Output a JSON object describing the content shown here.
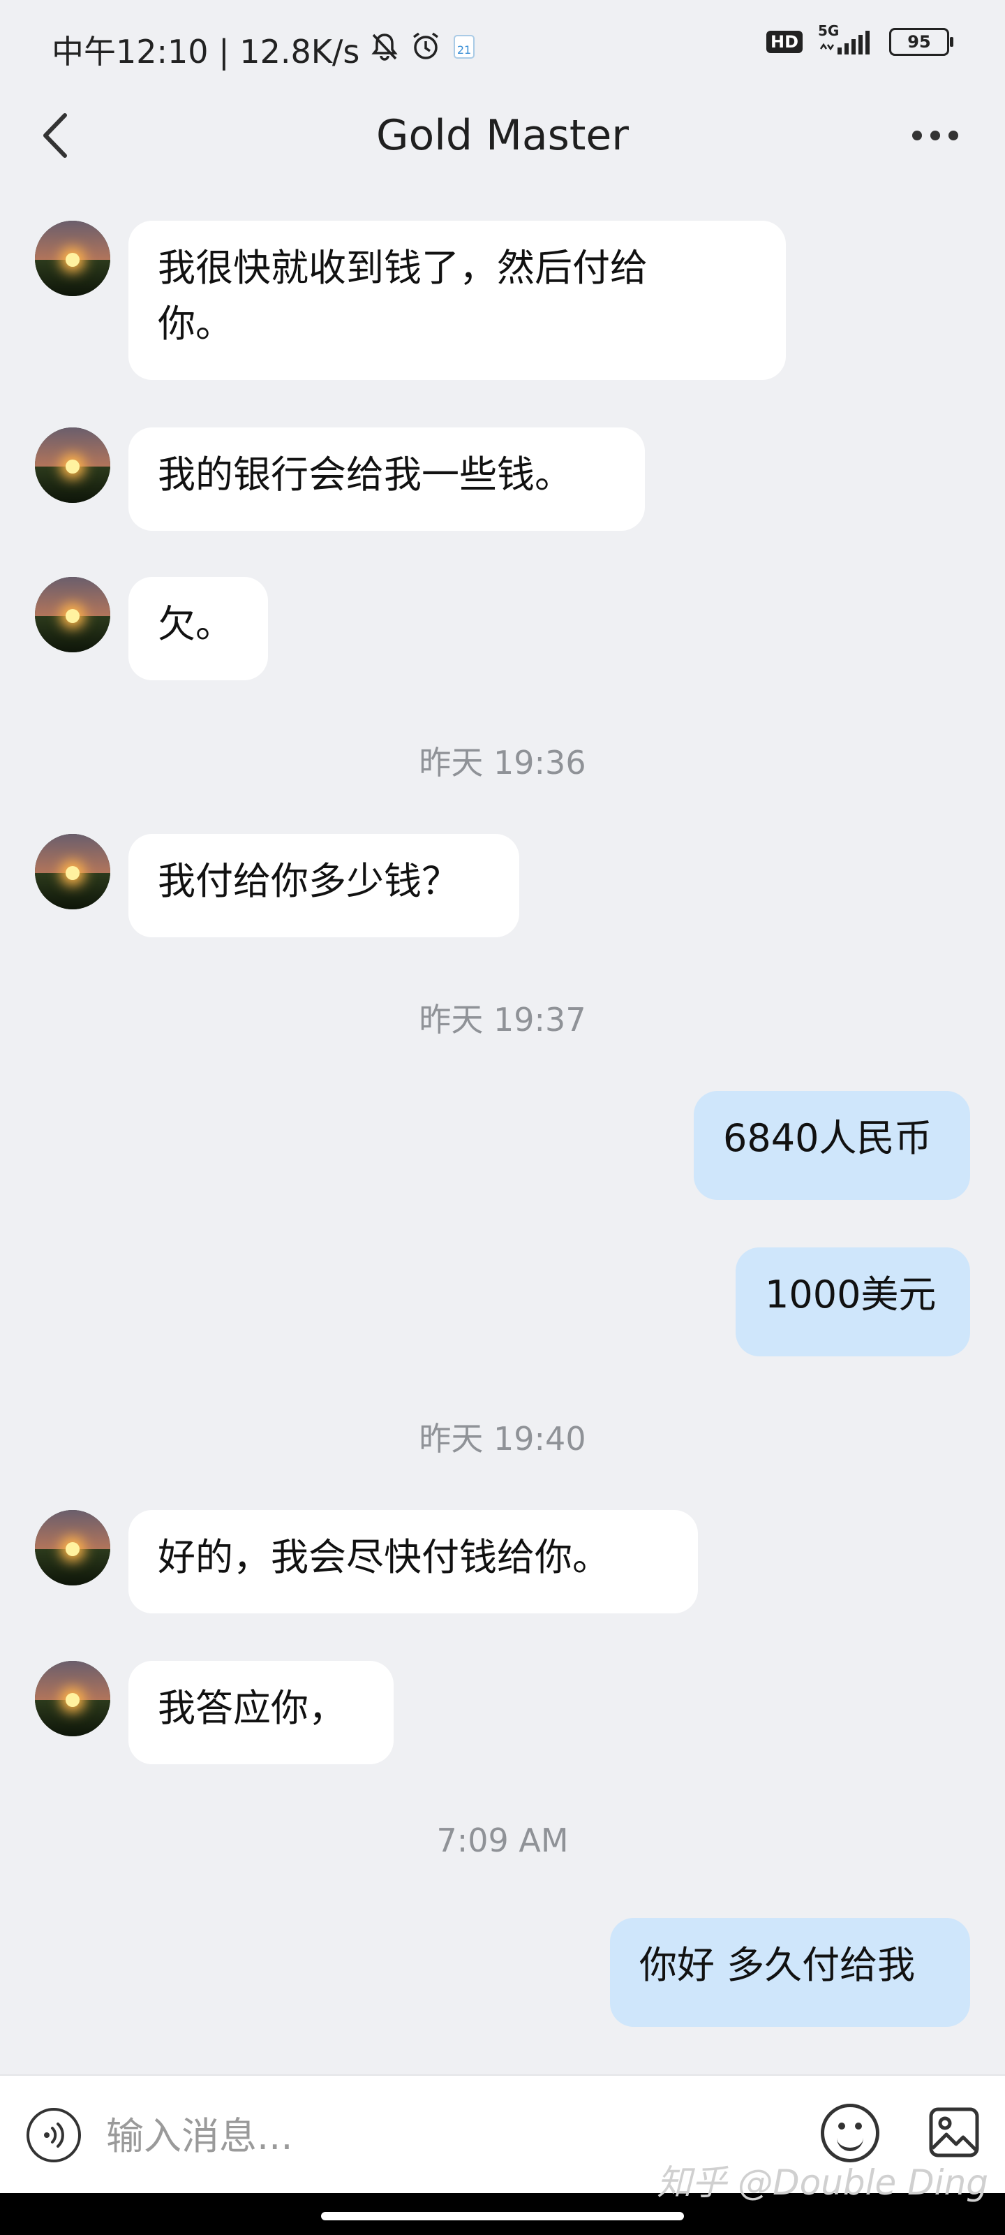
{
  "status_bar": {
    "time_speed": "中午12:10 | 12.8K/s",
    "hd_label": "HD",
    "network_label": "5G",
    "battery_level": "95"
  },
  "header": {
    "title": "Gold Master"
  },
  "messages": [
    {
      "side": "in",
      "text": "我很快就收到钱了，然后付给\n你。"
    },
    {
      "side": "in",
      "text": "我的银行会给我一些钱。"
    },
    {
      "side": "in",
      "text": "欠。"
    },
    {
      "side": "in",
      "text": "我付给你多少钱？"
    },
    {
      "side": "out",
      "text": "6840人民币"
    },
    {
      "side": "out",
      "text": "1000美元"
    },
    {
      "side": "in",
      "text": "好的，我会尽快付钱给你。"
    },
    {
      "side": "in",
      "text": "我答应你，"
    },
    {
      "side": "out",
      "text": "你好 多久付给我"
    }
  ],
  "timestamps": [
    "昨天 19:36",
    "昨天 19:37",
    "昨天 19:40",
    "7:09 AM"
  ],
  "input": {
    "placeholder": "输入消息..."
  },
  "watermark": "知乎 @Double Ding",
  "colors": {
    "background": "#eff0f3",
    "incoming_bubble": "#ffffff",
    "outgoing_bubble": "#cfe6fb"
  },
  "icons": {
    "back": "chevron-left-icon",
    "more": "more-dots-icon",
    "voice": "voice-icon",
    "emoji": "emoji-icon",
    "image": "image-icon"
  }
}
